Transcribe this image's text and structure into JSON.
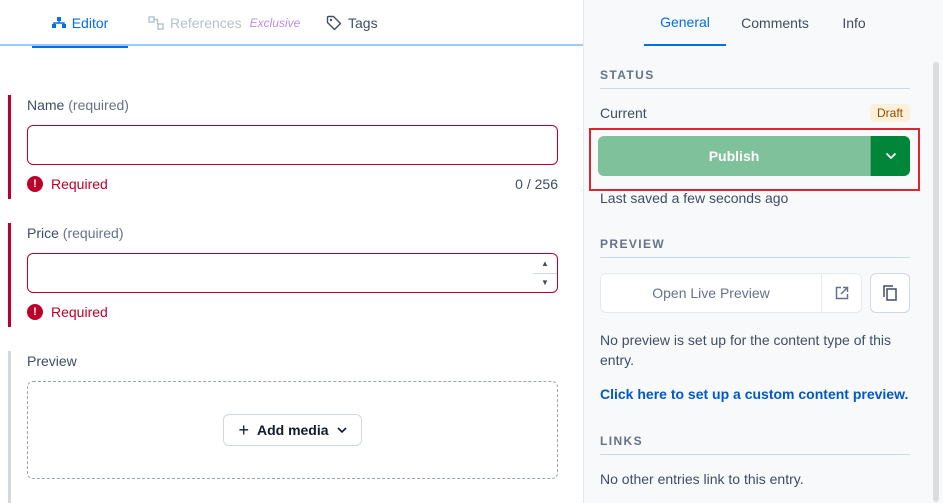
{
  "editor_tabs": {
    "editor": "Editor",
    "references": "References",
    "references_badge": "Exclusive",
    "tags": "Tags"
  },
  "fields": {
    "name": {
      "label": "Name",
      "required_hint": "(required)",
      "value": "",
      "error": "Required",
      "counter": "0 / 256"
    },
    "price": {
      "label": "Price",
      "required_hint": "(required)",
      "value": "",
      "error": "Required"
    },
    "preview": {
      "label": "Preview",
      "add_media": "Add media"
    }
  },
  "sidebar": {
    "tabs": {
      "general": "General",
      "comments": "Comments",
      "info": "Info"
    },
    "status": {
      "heading": "STATUS",
      "current_label": "Current",
      "badge": "Draft",
      "publish": "Publish",
      "last_saved": "Last saved a few seconds ago"
    },
    "preview": {
      "heading": "PREVIEW",
      "open_live": "Open Live Preview",
      "note": "No preview is set up for the content type of this entry.",
      "link": "Click here to set up a custom content preview."
    },
    "links": {
      "heading": "LINKS",
      "note": "No other entries link to this entry."
    }
  },
  "colors": {
    "accent": "#036fe3",
    "error": "#bd002a",
    "publish_disabled": "#7ec19a",
    "publish_dark": "#008539",
    "highlight_box": "#e0242e"
  }
}
